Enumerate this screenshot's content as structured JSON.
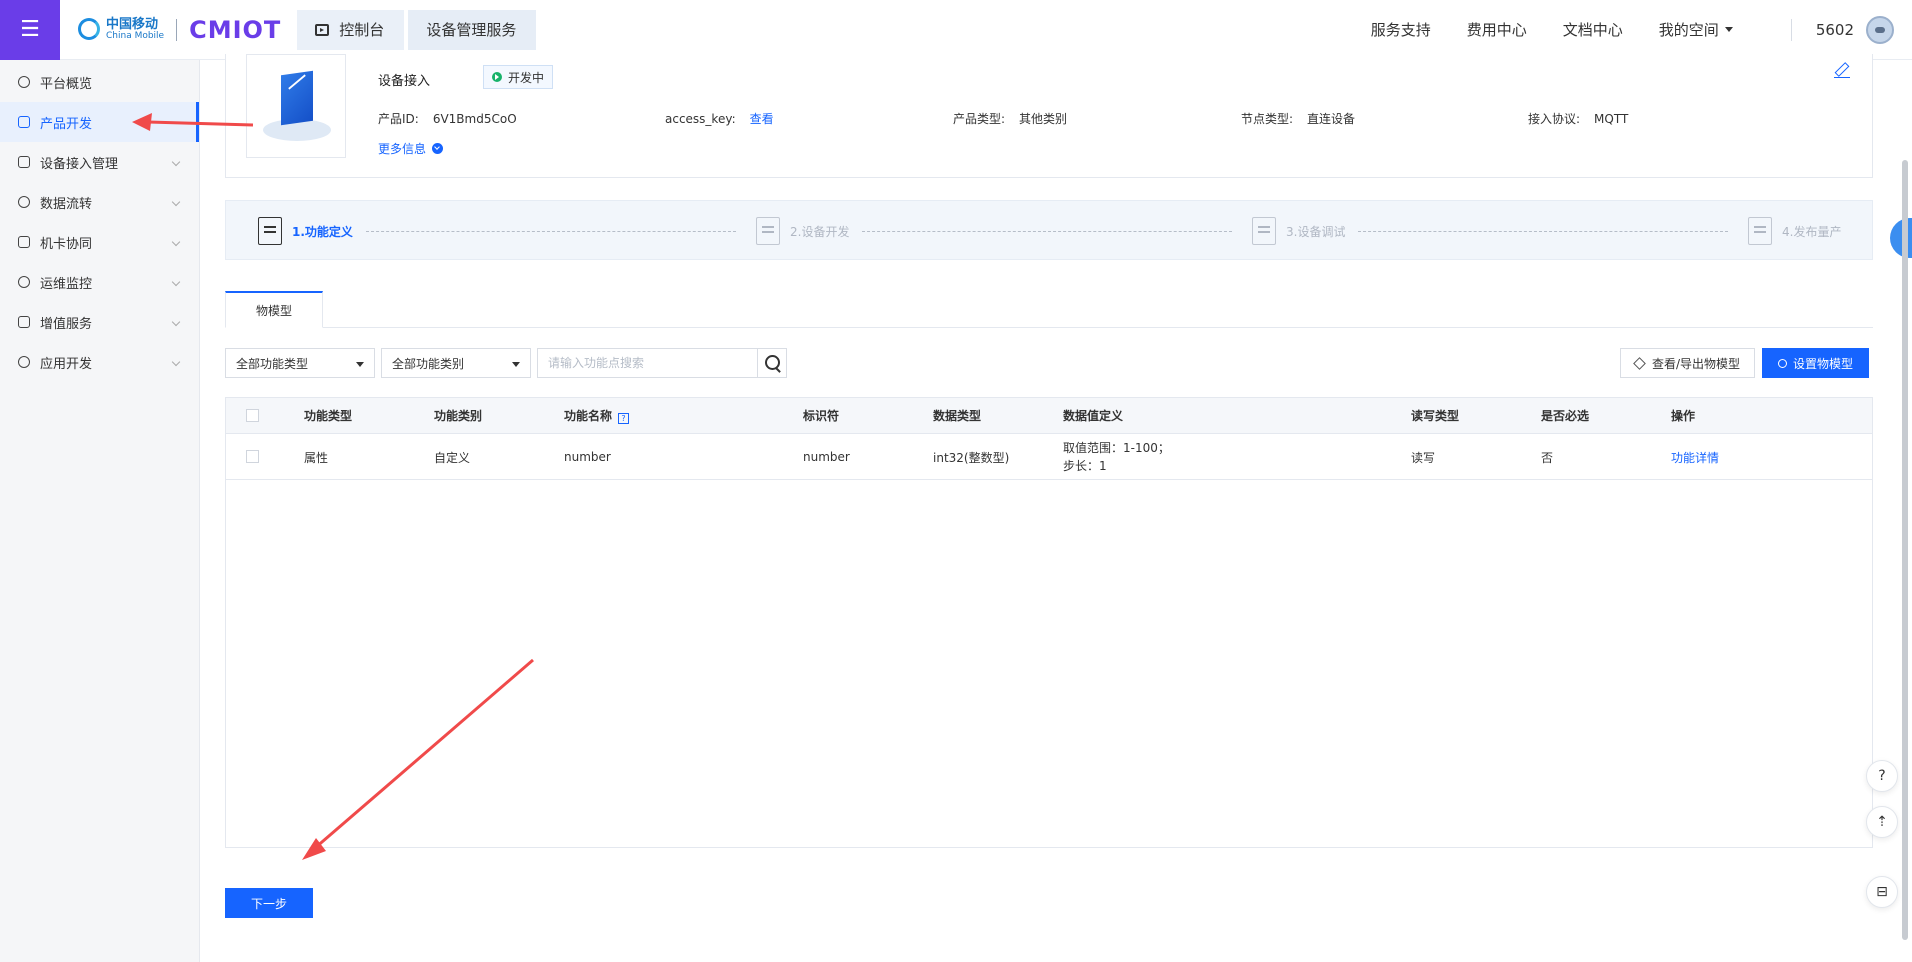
{
  "header": {
    "logo_cn": "中国移动",
    "logo_en": "China Mobile",
    "logo_brand": "CMIOT",
    "breadcrumbs": [
      "控制台",
      "设备管理服务"
    ],
    "nav": [
      "服务支持",
      "费用中心",
      "文档中心",
      "我的空间"
    ],
    "user_id": "5602"
  },
  "sidebar": {
    "items": [
      {
        "label": "平台概览",
        "icon": "overview-icon",
        "chevron": false
      },
      {
        "label": "产品开发",
        "icon": "cube-icon",
        "chevron": false,
        "active": true
      },
      {
        "label": "设备接入管理",
        "icon": "device-icon",
        "chevron": true
      },
      {
        "label": "数据流转",
        "icon": "dataflow-icon",
        "chevron": true
      },
      {
        "label": "机卡协同",
        "icon": "card-icon",
        "chevron": true
      },
      {
        "label": "运维监控",
        "icon": "monitor-icon",
        "chevron": true
      },
      {
        "label": "增值服务",
        "icon": "send-icon",
        "chevron": true
      },
      {
        "label": "应用开发",
        "icon": "app-icon",
        "chevron": true
      }
    ]
  },
  "product": {
    "name": "设备接入",
    "status": "开发中",
    "fields": [
      {
        "key": "产品ID:",
        "value": "6V1Bmd5CoO",
        "link": false
      },
      {
        "key": "access_key:",
        "value": "查看",
        "link": true
      },
      {
        "key": "产品类型:",
        "value": "其他类别",
        "link": false
      },
      {
        "key": "节点类型:",
        "value": "直连设备",
        "link": false
      },
      {
        "key": "接入协议:",
        "value": "MQTT",
        "link": false
      }
    ],
    "more_info": "更多信息"
  },
  "steps": [
    {
      "label": "1.功能定义",
      "active": true
    },
    {
      "label": "2.设备开发",
      "active": false
    },
    {
      "label": "3.设备调试",
      "active": false
    },
    {
      "label": "4.发布量产",
      "active": false
    }
  ],
  "tabs": [
    {
      "label": "物模型"
    }
  ],
  "filters": {
    "function_type": "全部功能类型",
    "function_category": "全部功能类别",
    "search_placeholder": "请输入功能点搜索"
  },
  "actions": {
    "view_export": "查看/导出物模型",
    "set_model": "设置物模型"
  },
  "table": {
    "columns": [
      "功能类型",
      "功能类别",
      "功能名称",
      "标识符",
      "数据类型",
      "数据值定义",
      "读写类型",
      "是否必选",
      "操作"
    ],
    "rows": [
      {
        "type": "属性",
        "category": "自定义",
        "name": "number",
        "identifier": "number",
        "data_type": "int32(整数型)",
        "definition_1": "取值范围：1-100；",
        "definition_2": "步长：1",
        "rw": "读写",
        "required": "否",
        "action": "功能详情"
      }
    ]
  },
  "next_button": "下一步"
}
